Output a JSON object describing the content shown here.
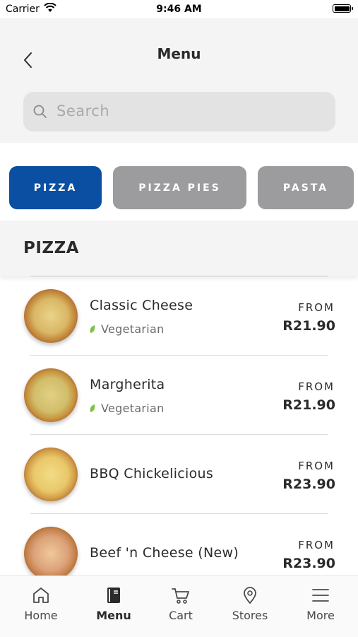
{
  "status_bar": {
    "carrier": "Carrier",
    "time": "9:46 AM"
  },
  "header": {
    "title": "Menu",
    "back_icon": "chevron-left-icon"
  },
  "search": {
    "placeholder": "Search",
    "icon": "search-icon"
  },
  "categories": [
    {
      "label": "PIZZA",
      "active": true
    },
    {
      "label": "PIZZA PIES",
      "active": false
    },
    {
      "label": "PASTA",
      "active": false
    }
  ],
  "section": {
    "title": "PIZZA"
  },
  "items": [
    {
      "name": "Classic Cheese",
      "tag": "Vegetarian",
      "from": "FROM",
      "price": "R21.90"
    },
    {
      "name": "Margherita",
      "tag": "Vegetarian",
      "from": "FROM",
      "price": "R21.90"
    },
    {
      "name": "BBQ Chickelicious",
      "tag": "",
      "from": "FROM",
      "price": "R23.90"
    },
    {
      "name": "Beef 'n Cheese (New)",
      "tag": "",
      "from": "FROM",
      "price": "R23.90"
    }
  ],
  "colors": {
    "accent": "#0a4fa1",
    "inactive_chip": "#9c9c9e",
    "veg_leaf": "#7cc243"
  },
  "tabs": [
    {
      "label": "Home",
      "icon": "home-icon",
      "active": false
    },
    {
      "label": "Menu",
      "icon": "menu-book-icon",
      "active": true
    },
    {
      "label": "Cart",
      "icon": "cart-icon",
      "active": false
    },
    {
      "label": "Stores",
      "icon": "location-pin-icon",
      "active": false
    },
    {
      "label": "More",
      "icon": "hamburger-icon",
      "active": false
    }
  ]
}
